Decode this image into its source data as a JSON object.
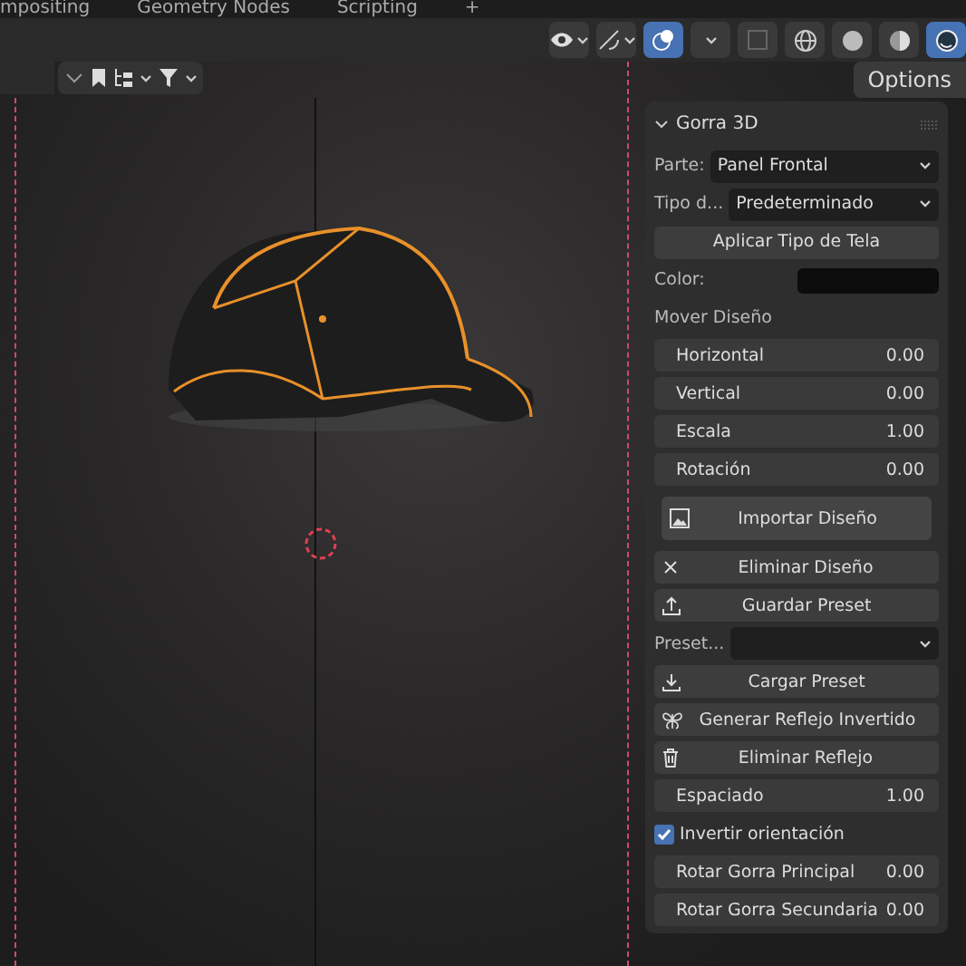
{
  "workspace_tabs": [
    {
      "label": "mpositing",
      "selected": false
    },
    {
      "label": "Geometry Nodes",
      "selected": false
    },
    {
      "label": "Scripting",
      "selected": false
    }
  ],
  "add_tab": "+",
  "shading_modes": [
    {
      "kind": "wireframe",
      "selected": false
    },
    {
      "kind": "solid",
      "selected": false
    },
    {
      "kind": "material",
      "selected": false
    },
    {
      "kind": "rendered",
      "selected": true
    }
  ],
  "overlays_on": true,
  "options_button": "Options",
  "panel": {
    "title": "Gorra 3D",
    "expanded": true,
    "items": [
      {
        "kind": "dropdown",
        "label": "Parte:",
        "value": "Panel Frontal"
      },
      {
        "kind": "dropdown",
        "label": "Tipo d...",
        "value": "Predeterminado"
      },
      {
        "kind": "button",
        "label": "Aplicar Tipo de Tela"
      },
      {
        "kind": "color",
        "label": "Color:",
        "color": "#0c0c0c"
      },
      {
        "kind": "label",
        "label": "Mover Diseño"
      },
      {
        "kind": "number",
        "label": "Horizontal",
        "value": "0.00"
      },
      {
        "kind": "number",
        "label": "Vertical",
        "value": "0.00"
      },
      {
        "kind": "number",
        "label": "Escala",
        "value": "1.00"
      },
      {
        "kind": "number",
        "label": "Rotación",
        "value": "0.00"
      },
      {
        "kind": "big_button",
        "label": "Importar Diseño"
      },
      {
        "kind": "button",
        "label": "Eliminar Diseño"
      },
      {
        "kind": "button",
        "label": "Guardar Preset"
      },
      {
        "kind": "dropdown",
        "label": "Preset..."
      },
      {
        "kind": "button",
        "label": "Cargar Preset"
      },
      {
        "kind": "button",
        "label": "Generar Reflejo Invertido"
      },
      {
        "kind": "button",
        "label": "Eliminar Reflejo"
      },
      {
        "kind": "number",
        "label": "Espaciado",
        "value": "1.00"
      },
      {
        "kind": "checkbox",
        "label": "Invertir orientación",
        "checked": true
      },
      {
        "kind": "number",
        "label": "Rotar Gorra Principal",
        "value": "0.00"
      },
      {
        "kind": "number",
        "label": "Rotar Gorra Secundaria",
        "value": "0.00"
      }
    ]
  }
}
